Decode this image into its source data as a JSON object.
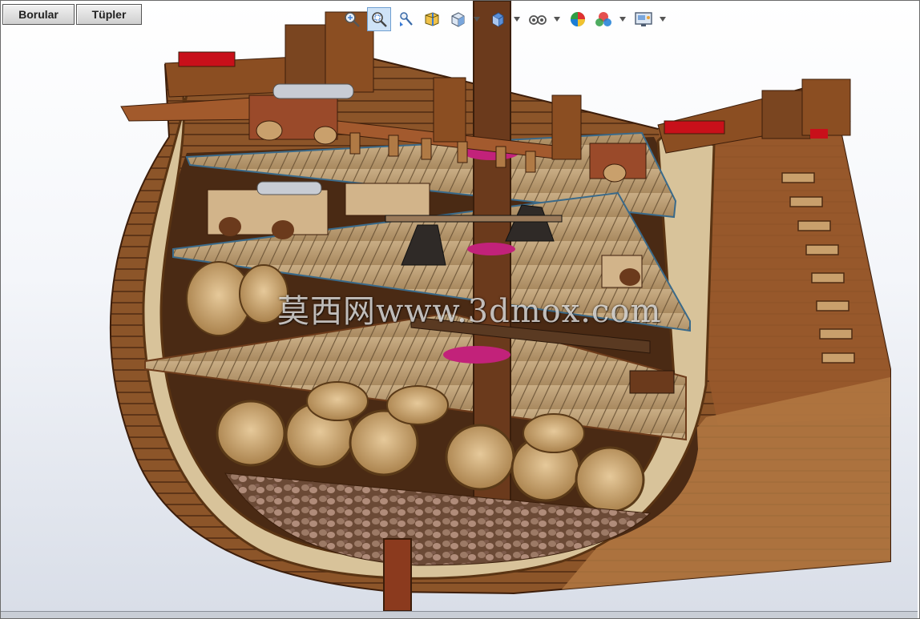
{
  "tabs": [
    {
      "label": "Borular"
    },
    {
      "label": "Tüpler"
    }
  ],
  "toolbar": {
    "buttons": [
      {
        "icon": "zoom-to-fit-icon"
      },
      {
        "icon": "zoom-to-area-icon",
        "active": true
      },
      {
        "icon": "previous-view-icon"
      },
      {
        "icon": "section-view-icon"
      },
      {
        "icon": "view-orientation-icon",
        "dropdown": true
      },
      {
        "icon": "display-style-icon",
        "dropdown": true
      },
      {
        "icon": "hide-show-items-icon",
        "dropdown": true
      },
      {
        "icon": "edit-appearance-icon"
      },
      {
        "icon": "apply-scene-icon",
        "dropdown": true
      },
      {
        "icon": "view-settings-icon",
        "dropdown": true
      }
    ]
  },
  "viewport": {
    "model": "ship-hull-cross-section",
    "watermark": "莫西网www.3dmox.com"
  },
  "colors": {
    "wood_dark": "#6b3a1c",
    "wood_mid": "#9a6338",
    "wood_light": "#c89a62",
    "deck": "#b89a72",
    "magenta": "#c2227a",
    "red": "#c8101a"
  }
}
